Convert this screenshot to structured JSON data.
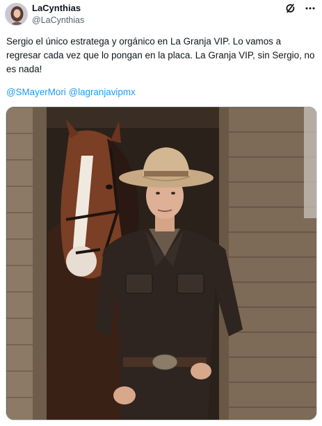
{
  "author": {
    "display_name": "LaCynthias",
    "handle": "@LaCynthias",
    "avatar_icon": "profile-photo"
  },
  "actions": {
    "grok_icon": "grok-icon",
    "more_icon": "more-options-icon",
    "more_label": "···"
  },
  "tweet": {
    "text": "Sergio el único estratega y orgánico en La Granja VIP. Lo vamos a regresar cada vez que lo pongan en la placa. La Granja VIP, sin Sergio, no es nada!",
    "mentions": [
      "@SMayerMori",
      "@lagranjavipmx"
    ]
  },
  "media": {
    "kind": "photo",
    "colors": {
      "wood": "#8a7560",
      "leather": "#2e2420",
      "hat": "#cfb08e",
      "horse": "#7a3f24"
    }
  }
}
